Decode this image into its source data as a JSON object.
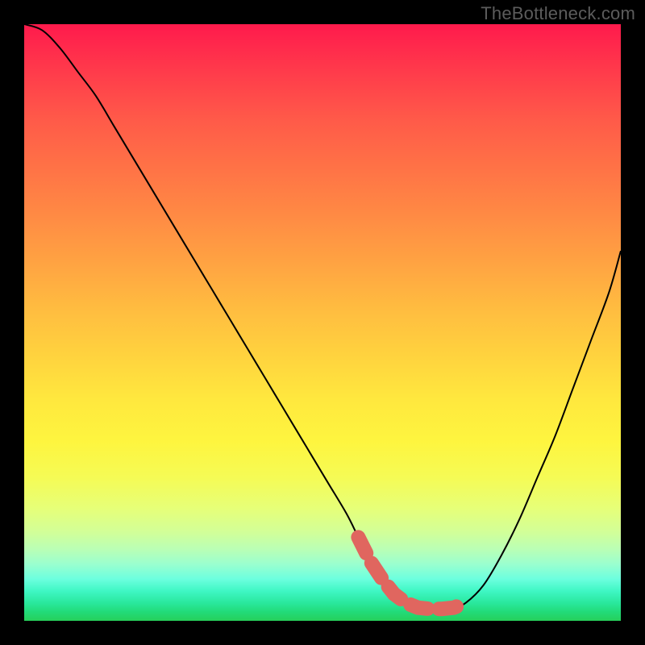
{
  "watermark": "TheBottleneck.com",
  "chart_data": {
    "type": "line",
    "title": "",
    "xlabel": "",
    "ylabel": "",
    "xlim": [
      0,
      100
    ],
    "ylim": [
      0,
      100
    ],
    "x": [
      0,
      3,
      6,
      9,
      12,
      15,
      18,
      21,
      24,
      27,
      30,
      33,
      36,
      39,
      42,
      45,
      48,
      51,
      54,
      56,
      58,
      60,
      62,
      64,
      66,
      68,
      70,
      72,
      74,
      77,
      80,
      83,
      86,
      89,
      92,
      95,
      98,
      100
    ],
    "y": [
      100,
      99,
      96,
      92,
      88,
      83,
      78,
      73,
      68,
      63,
      58,
      53,
      48,
      43,
      38,
      33,
      28,
      23,
      18,
      14,
      10,
      7,
      4.5,
      3,
      2.2,
      2,
      2,
      2.2,
      3,
      6,
      11,
      17,
      24,
      31,
      39,
      47,
      55,
      62
    ],
    "marker_band": {
      "y": 2.5,
      "x_start": 56,
      "x_end": 75
    },
    "gradient": {
      "top": "#ff1a4c",
      "mid": "#ffe83e",
      "bottom": "#26d05a"
    }
  }
}
